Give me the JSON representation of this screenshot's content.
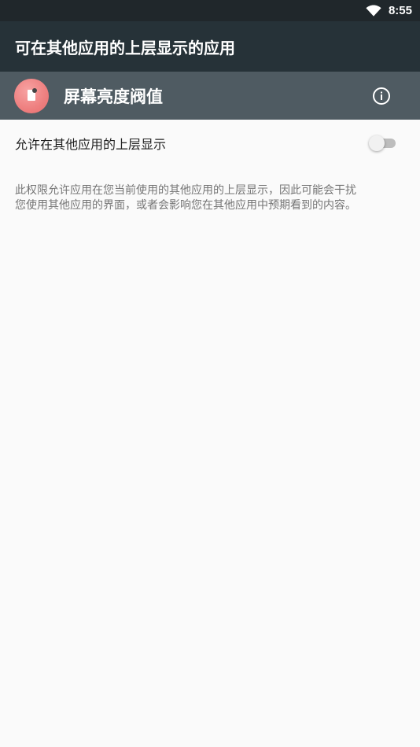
{
  "status_bar": {
    "time": "8:55",
    "wifi_icon": "wifi-icon"
  },
  "app_bar": {
    "title": "可在其他应用的上层显示的应用"
  },
  "app_header": {
    "app_name": "屏幕亮度阀值",
    "app_icon": "app-icon",
    "info_icon": "info-icon"
  },
  "setting": {
    "label": "允许在其他应用的上层显示",
    "enabled": false,
    "description_line1": "此权限允许应用在您当前使用的其他应用的上层显示，因此可能会干扰",
    "description_line2": "您使用其他应用的界面，或者会影响您在其他应用中预期看到的内容。"
  },
  "colors": {
    "status_bar": "#20272b",
    "app_bar": "#263238",
    "app_header": "#4f5b62",
    "background": "#fafafa"
  }
}
